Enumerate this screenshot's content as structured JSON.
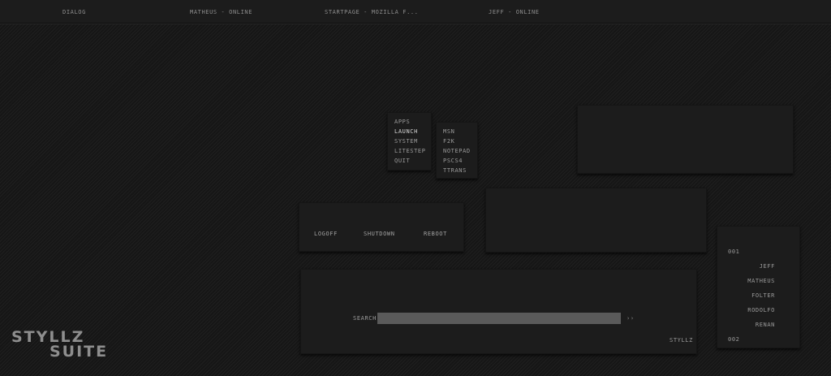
{
  "taskbar": {
    "tasks": [
      "DIALOG",
      "MATHEUS - ONLINE",
      "STARTPAGE - MOZILLA F...",
      "JEFF - ONLINE"
    ]
  },
  "main_menu": {
    "items": [
      {
        "label": "APPS",
        "active": false
      },
      {
        "label": "LAUNCH",
        "active": true
      },
      {
        "label": "SYSTEM",
        "active": false
      },
      {
        "label": "LITESTEP",
        "active": false
      },
      {
        "label": "QUIT",
        "active": false
      }
    ]
  },
  "launch_menu": {
    "items": [
      "MSN",
      "F2K",
      "NOTEPAD",
      "PSCS4",
      "TTRANS"
    ]
  },
  "power": {
    "logoff": "LOGOFF",
    "shutdown": "SHUTDOWN",
    "reboot": "REBOOT"
  },
  "search": {
    "label": "SEARCH",
    "value": "",
    "go": "››",
    "brand": "STYLLZ"
  },
  "contacts": {
    "group_start": "001",
    "names": [
      "JEFF",
      "MATHEUS",
      "FOLTER",
      "RODOLFO",
      "RENAN"
    ],
    "group_end": "002"
  },
  "logo": {
    "line1": "STYLLZ",
    "line2": "SUITE"
  },
  "colors": {
    "background": "#1b1b1b",
    "panel": "#1c1c1c",
    "text": "#8a8a8a",
    "active_text": "#d6d6d6",
    "search_field": "#5a5a5a"
  }
}
